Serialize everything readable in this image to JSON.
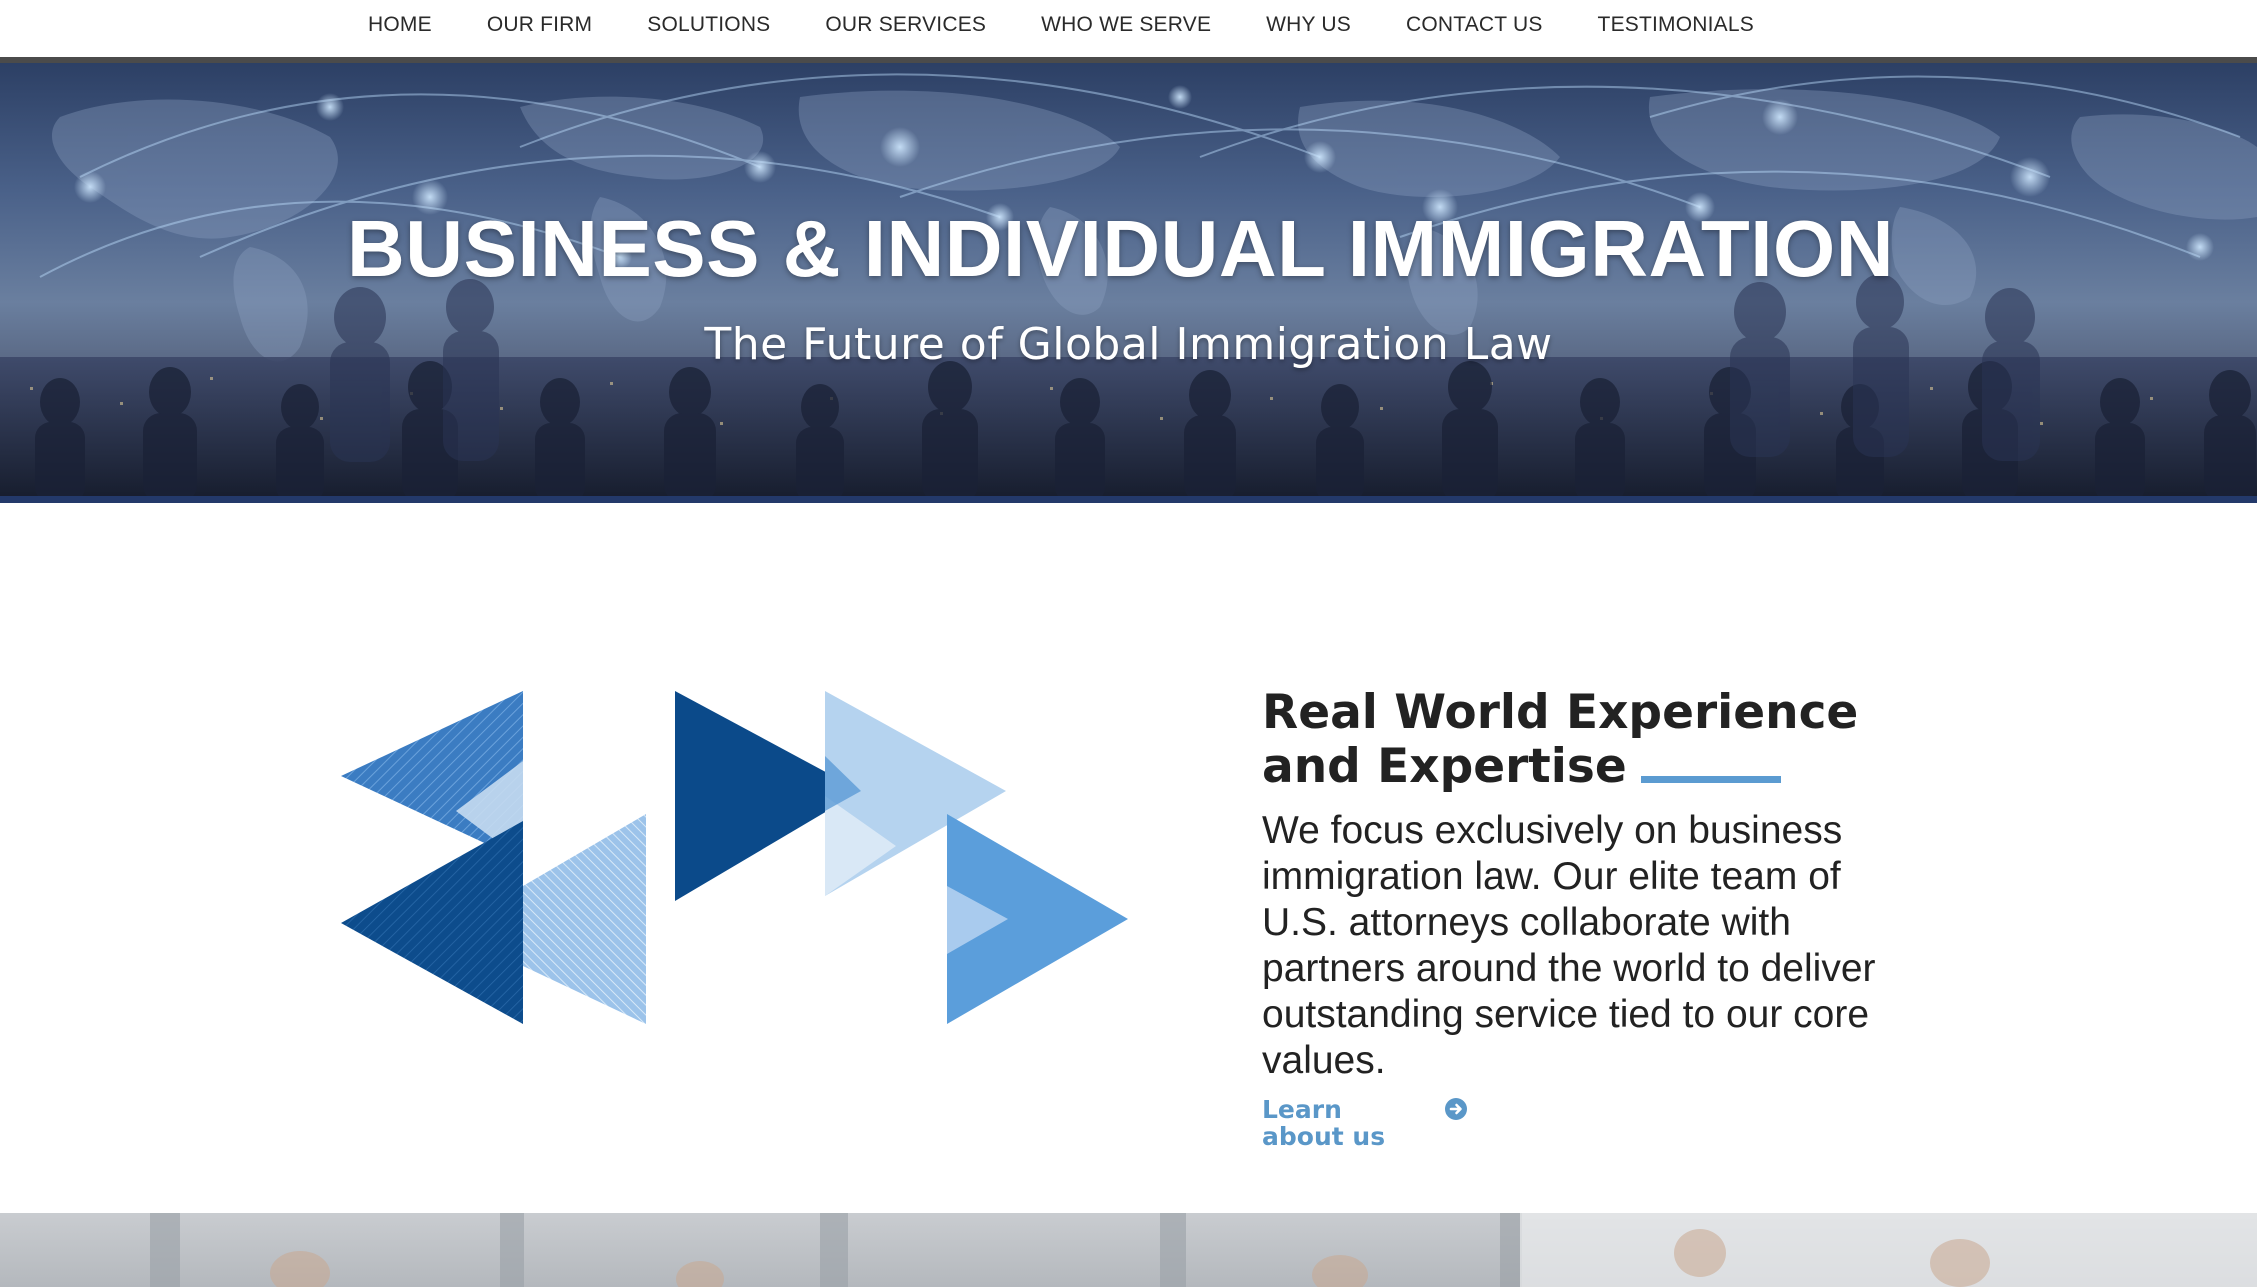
{
  "nav": {
    "items": [
      "HOME",
      "OUR FIRM",
      "SOLUTIONS",
      "OUR SERVICES",
      "WHO WE SERVE",
      "WHY US",
      "CONTACT US",
      "TESTIMONIALS"
    ]
  },
  "hero": {
    "title": "BUSINESS & INDIVIDUAL IMMIGRATION",
    "subtitle": "The Future of Global Immigration Law"
  },
  "about": {
    "heading_line1": "Real World Experience",
    "heading_line2": "and Expertise",
    "body": "We focus exclusively on business immigration law. Our elite team of U.S. attorneys collaborate with partners around the world to deliver outstanding service tied to our core values.",
    "link_label": "Learn about us",
    "link_icon": "arrow-circle-right-icon"
  },
  "colors": {
    "accent": "#5b9bd1",
    "navy": "#0b4a8a",
    "hero_bottom_line": "#23396a"
  }
}
